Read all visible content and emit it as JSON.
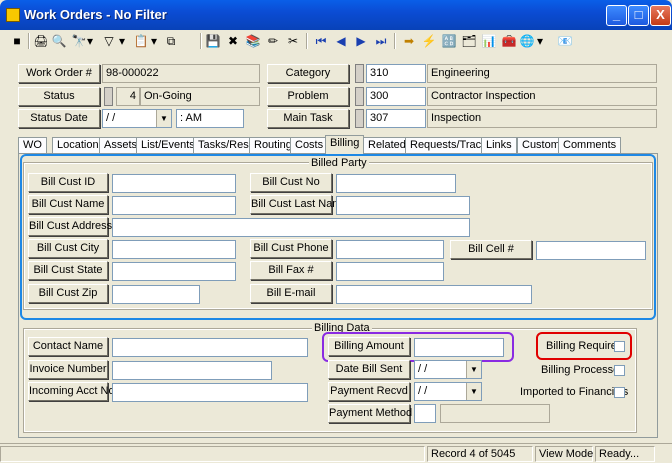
{
  "window": {
    "title": "Work Orders - No Filter",
    "min": "_",
    "max": "□",
    "close": "X"
  },
  "toolbar": {
    "icons": [
      "■",
      "🖨",
      "🔍",
      "🔭",
      "▾",
      "▽",
      "▾",
      "📋",
      "▾",
      "⧉",
      "💾",
      "✖",
      "📚",
      "✏",
      "✂",
      "⏮",
      "◀",
      "▶",
      "⏭",
      "➡",
      "⚡",
      "🔠",
      "🗂",
      "📊",
      "🧰",
      "🌐",
      "▾",
      "📧"
    ]
  },
  "header": {
    "work_order_label": "Work Order #",
    "work_order_value": "98-000022",
    "status_label": "Status",
    "status_code": "4",
    "status_text": "On-Going",
    "status_date_label": "Status Date",
    "status_date_value": " / /",
    "status_time_value": " :  AM",
    "category_label": "Category",
    "category_code": "310",
    "category_text": "Engineering",
    "problem_label": "Problem",
    "problem_code": "300",
    "problem_text": "Contractor Inspection",
    "main_task_label": "Main Task",
    "main_task_code": "307",
    "main_task_text": "Inspection"
  },
  "tabs": [
    "WO",
    "Location",
    "Assets",
    "List/Events",
    "Tasks/Res",
    "Routing",
    "Costs",
    "Billing",
    "Related",
    "Requests/Track",
    "Links",
    "Custom",
    "Comments"
  ],
  "billed_party": {
    "title": "Billed Party",
    "cust_id": "Bill Cust ID",
    "cust_no": "Bill Cust No",
    "cust_name": "Bill Cust Name",
    "cust_last_name": "Bill Cust Last Name",
    "cust_address": "Bill Cust Address",
    "cust_city": "Bill Cust City",
    "cust_phone": "Bill Cust Phone",
    "cell": "Bill Cell #",
    "cust_state": "Bill Cust State",
    "fax": "Bill Fax #",
    "cust_zip": "Bill Cust Zip",
    "email": "Bill E-mail"
  },
  "billing_data": {
    "title": "Billing Data",
    "contact_name": "Contact Name",
    "billing_amount": "Billing Amount",
    "billing_required": "Billing Required",
    "invoice_number": "Invoice Number",
    "date_bill_sent": "Date Bill Sent",
    "date_bill_sent_value": " / /",
    "billing_processed": "Billing Processed",
    "incoming_acct": "Incoming Acct No",
    "payment_recvd": "Payment Recvd",
    "payment_recvd_value": " / /",
    "imported": "Imported to Financials",
    "payment_method": "Payment Method"
  },
  "highlights": {
    "amount_color": "#8A2BE2",
    "required_color": "#E00000",
    "party_color": "#1E88E5"
  },
  "status_bar": {
    "record": "Record 4 of 5045",
    "mode": "View Mode",
    "state": "Ready..."
  }
}
